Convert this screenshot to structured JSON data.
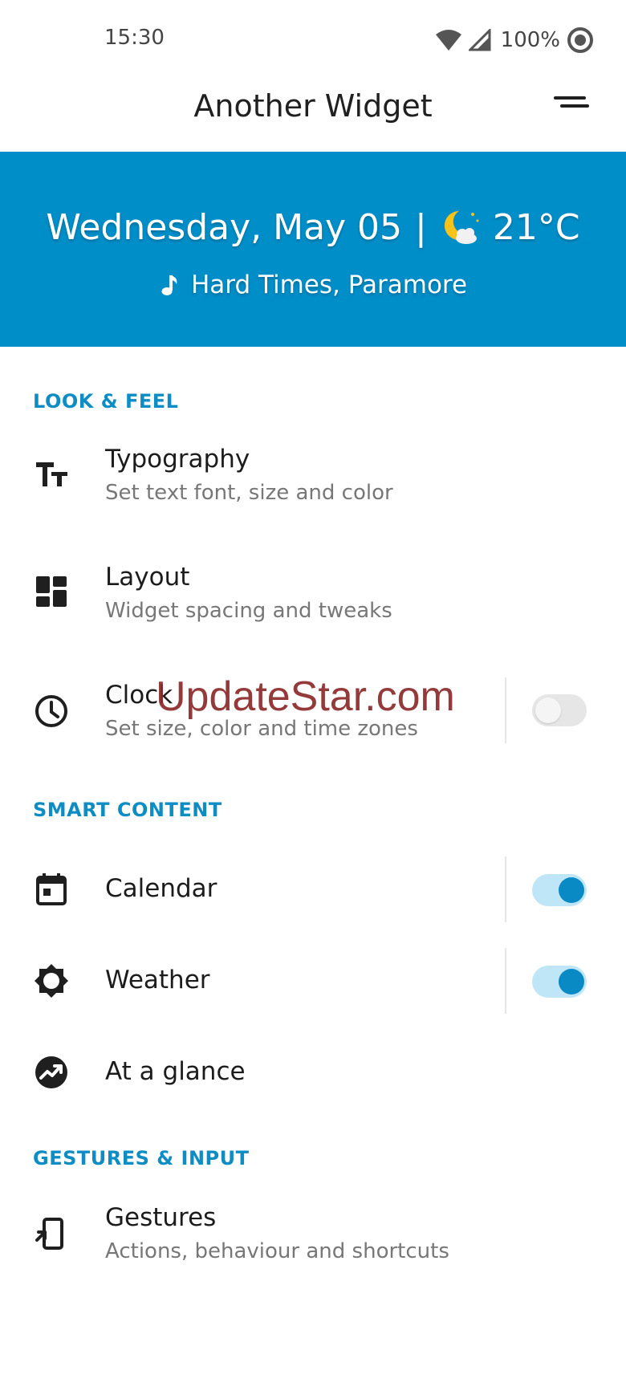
{
  "status_bar": {
    "time": "15:30",
    "battery": "100%"
  },
  "app_bar": {
    "title": "Another Widget",
    "menu_icon": "menu-icon"
  },
  "preview": {
    "date": "Wednesday, May 05",
    "separator": "|",
    "temperature": "21°C",
    "weather_icon": "partly-cloudy-night-icon",
    "music": "Hard Times, Paramore",
    "background_color": "#008ec9"
  },
  "sections": {
    "look_feel": "LOOK & FEEL",
    "smart_content": "SMART CONTENT",
    "gestures_input": "GESTURES & INPUT"
  },
  "items": {
    "typography": {
      "title": "Typography",
      "subtitle": "Set text font, size and color",
      "icon": "text-fields-icon"
    },
    "layout": {
      "title": "Layout",
      "subtitle": "Widget spacing and tweaks",
      "icon": "dashboard-icon"
    },
    "clock": {
      "title": "Clock",
      "subtitle": "Set size, color and time zones",
      "icon": "clock-icon",
      "enabled": false
    },
    "calendar": {
      "title": "Calendar",
      "icon": "calendar-icon",
      "enabled": true
    },
    "weather": {
      "title": "Weather",
      "icon": "brightness-icon",
      "enabled": true
    },
    "glance": {
      "title": "At a glance",
      "icon": "trending-up-icon"
    },
    "gestures": {
      "title": "Gestures",
      "subtitle": "Actions, behaviour and shortcuts",
      "icon": "touch-app-icon"
    }
  },
  "watermark": "UpdateStar.com",
  "colors": {
    "accent": "#0e8cc4",
    "toggle_on_track": "#bfe6f6",
    "toggle_on_thumb": "#0a8ac4"
  }
}
